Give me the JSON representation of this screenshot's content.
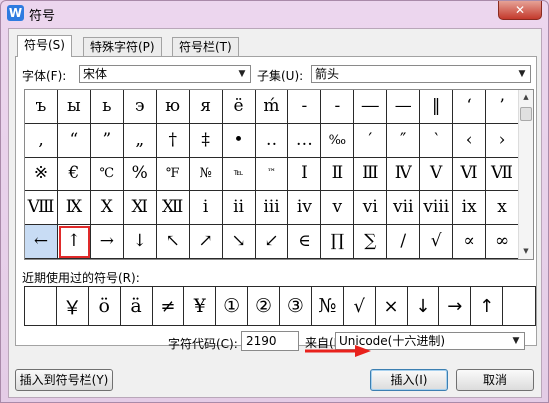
{
  "window": {
    "title": "符号",
    "app_icon": "W",
    "close_label": "✕"
  },
  "tabs": [
    "符号(S)",
    "特殊字符(P)",
    "符号栏(T)"
  ],
  "font": {
    "label": "字体(F):",
    "value": "宋体"
  },
  "subset": {
    "label": "子集(U):",
    "value": "箭头"
  },
  "symbols": [
    [
      "ъ",
      "ы",
      "ь",
      "э",
      "ю",
      "я",
      "ё",
      "ḿ",
      "-",
      "‐",
      "―",
      "—",
      "‖",
      "‘",
      "’"
    ],
    [
      "‚",
      "“",
      "”",
      "„",
      "†",
      "‡",
      "•",
      "‥",
      "…",
      "‰",
      "′",
      "″",
      "‵",
      "‹",
      "›"
    ],
    [
      "※",
      "€",
      "℃",
      "%",
      "℉",
      "№",
      "℡",
      "™",
      "Ⅰ",
      "Ⅱ",
      "Ⅲ",
      "Ⅳ",
      "Ⅴ",
      "Ⅵ",
      "Ⅶ"
    ],
    [
      "Ⅷ",
      "Ⅸ",
      "Ⅹ",
      "Ⅺ",
      "Ⅻ",
      "ⅰ",
      "ⅱ",
      "ⅲ",
      "ⅳ",
      "ⅴ",
      "ⅵ",
      "ⅶ",
      "ⅷ",
      "ⅸ",
      "ⅹ"
    ],
    [
      "←",
      "↑",
      "→",
      "↓",
      "↖",
      "↗",
      "↘",
      "↙",
      "∈",
      "∏",
      "∑",
      "∕",
      "√",
      "∝",
      "∞"
    ]
  ],
  "selected_symbol": "↑",
  "recent": {
    "label": "近期使用过的符号(R):",
    "items": [
      "",
      "￥",
      "ö",
      "ä",
      "≠",
      "¥",
      "①",
      "②",
      "③",
      "№",
      "√",
      "×",
      "↓",
      "→",
      "↑",
      ""
    ]
  },
  "char_code": {
    "label": "字符代码(C):",
    "value": "2190",
    "from_label": "来自(M)",
    "from_value": "Unicode(十六进制)"
  },
  "buttons": {
    "insert_to_bar": "插入到符号栏(Y)",
    "insert": "插入(I)",
    "cancel": "取消"
  },
  "colors": {
    "selection_outline": "#e02a2a",
    "arrow": "#e8211c",
    "highlight": "#c8dcf4"
  }
}
